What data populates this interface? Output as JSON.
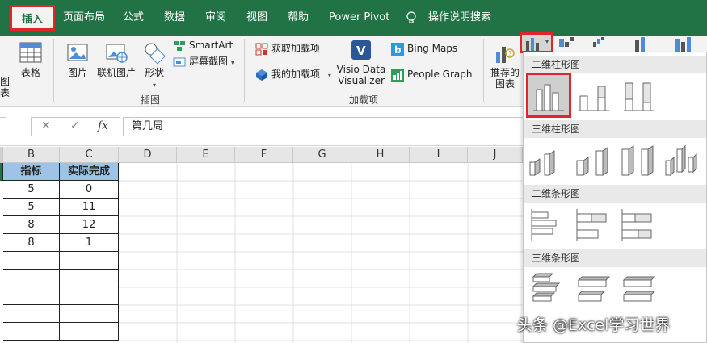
{
  "tabs": [
    {
      "label": "插入",
      "active": true
    },
    {
      "label": "页面布局"
    },
    {
      "label": "公式"
    },
    {
      "label": "数据"
    },
    {
      "label": "审阅"
    },
    {
      "label": "视图"
    },
    {
      "label": "帮助"
    },
    {
      "label": "Power Pivot"
    }
  ],
  "tell_me": "操作说明搜索",
  "ribbon": {
    "partial_left_label": "图表",
    "table_label": "表格",
    "picture_label": "图片",
    "online_picture_label": "联机图片",
    "shapes_label": "形状",
    "smartart_label": "SmartArt",
    "screenshot_label": "屏幕截图",
    "illustrations_group": "插图",
    "get_addins_label": "获取加载项",
    "my_addins_label": "我的加载项",
    "visio_label_1": "Visio Data",
    "visio_label_2": "Visualizer",
    "bing_maps_label": "Bing Maps",
    "people_graph_label": "People Graph",
    "addins_group": "加载项",
    "recommended_label_1": "推荐的",
    "recommended_label_2": "图表"
  },
  "formula_bar": {
    "cancel": "✕",
    "enter": "✓",
    "fx": "fx",
    "content": "第几周"
  },
  "grid": {
    "columns": [
      "B",
      "C",
      "D",
      "E",
      "F",
      "G",
      "H",
      "I",
      "J"
    ],
    "header_row": {
      "b": "指标",
      "c": "实际完成"
    },
    "rows": [
      {
        "b": "5",
        "c": "0"
      },
      {
        "b": "5",
        "c": "11"
      },
      {
        "b": "8",
        "c": "12"
      },
      {
        "b": "8",
        "c": "1"
      }
    ]
  },
  "chart_menu": {
    "sections": [
      {
        "title": "二维柱形图"
      },
      {
        "title": "三维柱形图"
      },
      {
        "title": "二维条形图"
      },
      {
        "title": "三维条形图"
      }
    ]
  },
  "watermark": "头条 @Excel学习世界",
  "colors": {
    "excel_green": "#217346",
    "highlight_red": "#e0252b",
    "header_blue": "#9dc3e6"
  }
}
